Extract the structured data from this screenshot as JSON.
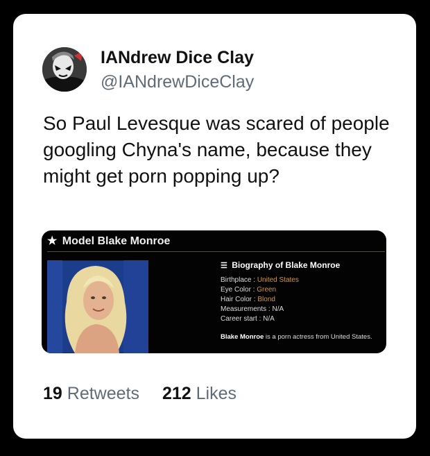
{
  "tweet": {
    "display_name": "IANdrew Dice Clay",
    "handle": "@IANdrewDiceClay",
    "text": "So Paul Levesque was scared of people googling Chyna's name, because they might get porn popping up?"
  },
  "media": {
    "header_title": "Model Blake Monroe",
    "bio_title": "Biography of Blake Monroe",
    "rows": [
      {
        "label": "Birthplace : ",
        "value": "United States"
      },
      {
        "label": "Eye Color : ",
        "value": "Green"
      },
      {
        "label": "Hair Color : ",
        "value": "Blond"
      },
      {
        "label": "Measurements : ",
        "value": "N/A"
      },
      {
        "label": "Career start : ",
        "value": "N/A"
      }
    ],
    "summary_name": "Blake Monroe",
    "summary_rest": " is a porn actress from United States."
  },
  "stats": {
    "retweets_count": "19",
    "retweets_label": "Retweets",
    "likes_count": "212",
    "likes_label": "Likes"
  },
  "colors": {
    "background": "#000000",
    "card": "#ffffff",
    "secondary_text": "#5f6c78",
    "bio_value": "#d59a3d"
  },
  "icons": [
    "star-icon",
    "list-icon"
  ]
}
